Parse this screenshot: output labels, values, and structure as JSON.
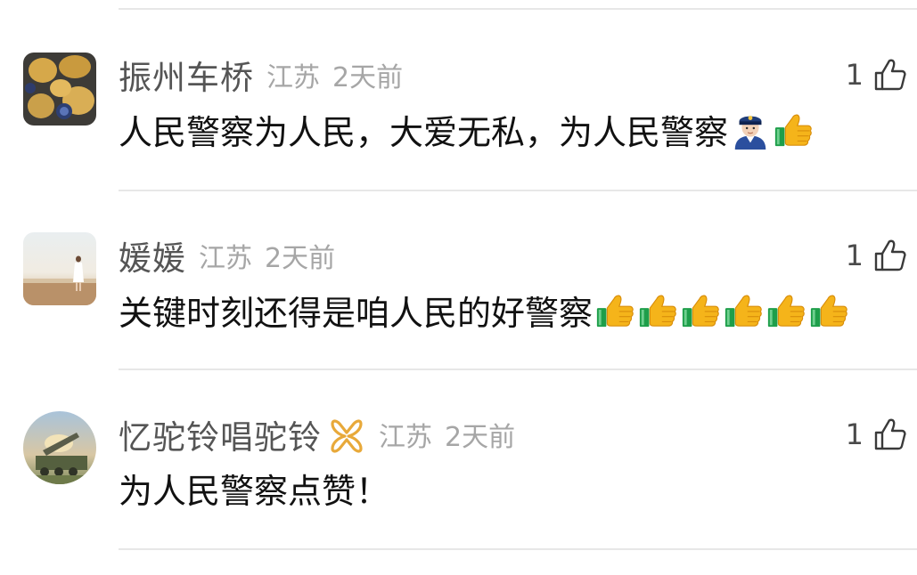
{
  "comments": [
    {
      "username": "振州车桥",
      "location": "江苏",
      "time": "2天前",
      "likes": "1",
      "text": "人民警察为人民，大爱无私，为人民警察",
      "emojis": [
        "police-officer",
        "thumbs-up"
      ]
    },
    {
      "username": "媛媛",
      "location": "江苏",
      "time": "2天前",
      "likes": "1",
      "text": "关键时刻还得是咱人民的好警察",
      "emojis": [
        "thumbs-up",
        "thumbs-up",
        "thumbs-up",
        "thumbs-up",
        "thumbs-up",
        "thumbs-up"
      ]
    },
    {
      "username": "忆驼铃唱驼铃",
      "badge": "gold-ribbon",
      "location": "江苏",
      "time": "2天前",
      "likes": "1",
      "text": "为人民警察点赞！",
      "emojis": []
    }
  ],
  "colors": {
    "username": "#555555",
    "meta": "#a6a6a6",
    "body_text": "#111111",
    "divider": "#e7e7e7",
    "badge_gold": "#e8a93a"
  }
}
